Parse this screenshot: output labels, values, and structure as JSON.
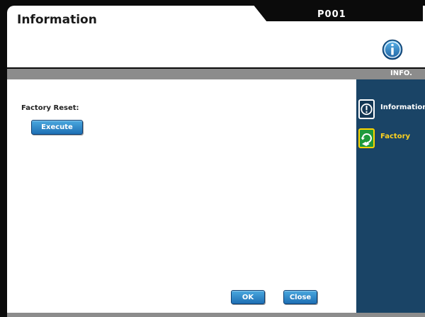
{
  "header": {
    "title": "Information",
    "code": "P001",
    "icon": "info-circle-icon"
  },
  "section_bar": {
    "label": "INFO."
  },
  "main": {
    "factory_reset_label": "Factory Reset:",
    "execute_label": "Execute"
  },
  "sidebar": {
    "items": [
      {
        "label": "Information",
        "icon": "alert-circle-icon",
        "selected": false
      },
      {
        "label": "Factory",
        "icon": "factory-reset-icon",
        "selected": true
      }
    ]
  },
  "footer": {
    "ok_label": "OK",
    "close_label": "Close"
  },
  "colors": {
    "accent_blue": "#2b86cc",
    "nav_bg": "#1a4466",
    "selected_label": "#ffd21f",
    "factory_icon_green": "#1e9a3b",
    "bar_gray": "#8c8c8c"
  }
}
